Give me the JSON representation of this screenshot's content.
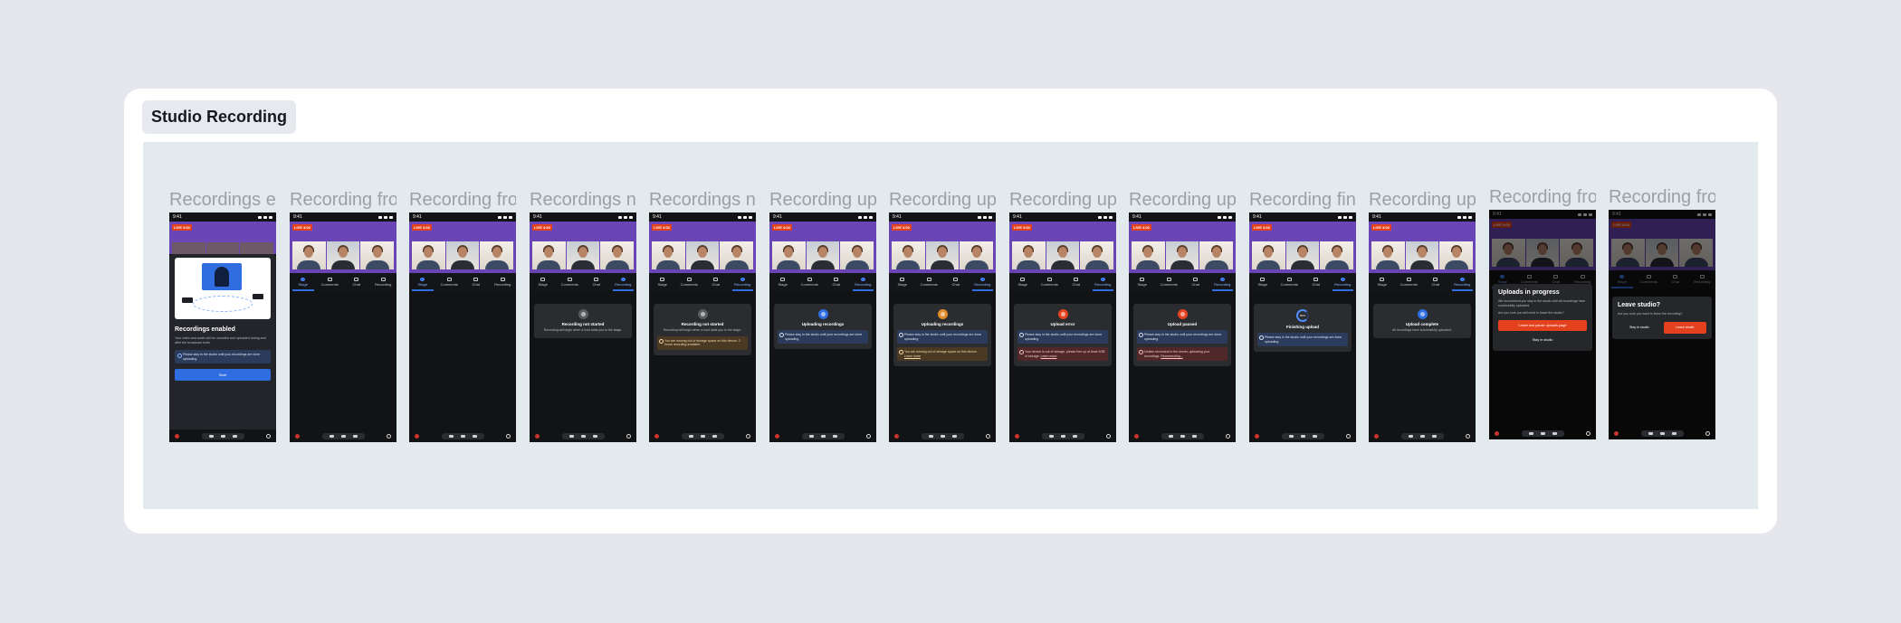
{
  "section": {
    "title": "Studio Recording"
  },
  "colors": {
    "brand_purple": "#6a45b6",
    "accent_blue": "#2f6de0",
    "danger": "#e4421f",
    "warning": "#e08c2a"
  },
  "status_bar": {
    "time": "9:41"
  },
  "live_badge": "LIVE 4:02",
  "tabs": [
    "Stage",
    "Comments",
    "Chat",
    "Recording"
  ],
  "frames": [
    {
      "title": "Recordings enabled",
      "onboarding": {
        "heading": "Recordings enabled",
        "body": "Your video and audio will be recorded and uploaded during and after the broadcast ends.",
        "note": "Please stay in the studio until your recordings are done uploading.",
        "button": "Start"
      }
    },
    {
      "title": "Recording from Stage"
    },
    {
      "title": "Recording from Stage"
    },
    {
      "title": "Recordings not started",
      "card": {
        "state": "idle",
        "title": "Recording not started",
        "body": "Recording will begin when a host adds you to the stage."
      }
    },
    {
      "title": "Recordings not started",
      "card": {
        "state": "idle",
        "title": "Recording not started",
        "body": "Recording will begin when a host adds you to the stage.",
        "note": {
          "kind": "warn",
          "text": "You are running out of storage space on this device. 2 hours recording available."
        }
      }
    },
    {
      "title": "Recording uploading",
      "card": {
        "state": "uploading",
        "title": "Uploading recordings",
        "note": {
          "kind": "blue",
          "text": "Please stay in the studio until your recordings are done uploading."
        }
      }
    },
    {
      "title": "Recording uploading",
      "card": {
        "state": "uploading-warn",
        "title": "Uploading recordings",
        "note": {
          "kind": "blue",
          "text": "Please stay in the studio until your recordings are done uploading."
        },
        "note2": {
          "kind": "warn",
          "text": "You are running out of storage space on this device.",
          "link": "Learn more"
        }
      }
    },
    {
      "title": "Recording upload error",
      "card": {
        "state": "error",
        "title": "Upload error",
        "note": {
          "kind": "blue",
          "text": "Please stay in the studio until your recordings are done uploading."
        },
        "note2": {
          "kind": "red",
          "text": "Your device is out of storage, please free up at least 3GB of storage.",
          "link": "Learn more"
        }
      }
    },
    {
      "title": "Recording upload paused",
      "card": {
        "state": "error",
        "title": "Upload paused",
        "note": {
          "kind": "blue",
          "text": "Please stay in the studio until your recordings are done uploading."
        },
        "note2": {
          "kind": "red",
          "text": "Unable reconnect to the server, uploading your recordings.",
          "link": "Reconnecting..."
        }
      }
    },
    {
      "title": "Recording finishing upload",
      "card": {
        "state": "progress",
        "progress": "80%",
        "title": "Finishing upload",
        "note": {
          "kind": "blue",
          "text": "Please stay in the studio until your recordings are done uploading."
        }
      }
    },
    {
      "title": "Recording upload complete",
      "card": {
        "state": "complete",
        "title": "Upload complete",
        "body": "All recordings have successfully uploaded."
      }
    },
    {
      "title": "Recording from Stage",
      "modal": {
        "type": "uploads",
        "title": "Uploads in progress",
        "body": "We recommend you stay in the studio until all recordings have successfully uploaded.",
        "body2": "Are you sure you still need to leave the studio?",
        "primary": "Leave and pause uploads page",
        "secondary": "Stay in studio"
      }
    },
    {
      "title": "Recording from Stage",
      "modal": {
        "type": "leave",
        "title": "Leave studio?",
        "body": "Are you sure you want to leave the recording?",
        "secondary": "Stay in studio",
        "primary": "Leave studio"
      }
    }
  ]
}
